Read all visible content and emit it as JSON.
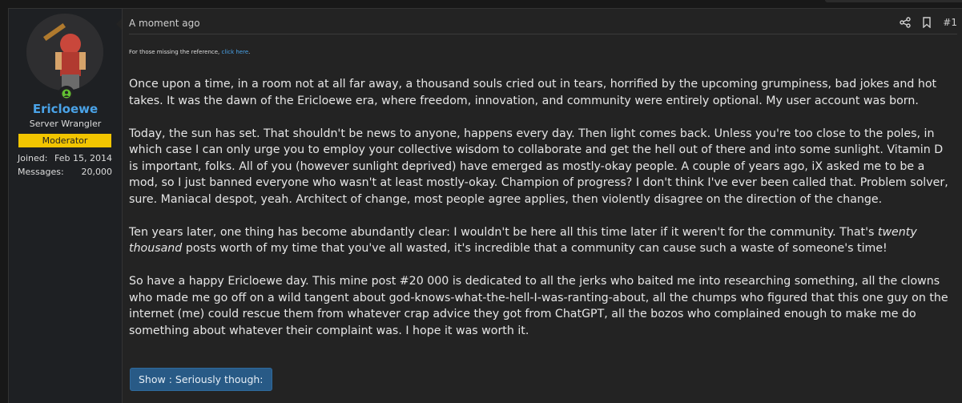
{
  "user": {
    "name": "Ericloewe",
    "title": "Server Wrangler",
    "banner": "Moderator",
    "joined_label": "Joined:",
    "joined_value": "Feb 15, 2014",
    "messages_label": "Messages:",
    "messages_value": "20,000"
  },
  "post": {
    "timestamp": "A moment ago",
    "number": "#1",
    "note_prefix": "For those missing the reference, ",
    "note_link": "click here",
    "note_suffix": ".",
    "p1": "Once upon a time, in a room not at all far away, a thousand souls cried out in tears, horrified by the upcoming grumpiness, bad jokes and hot takes. It was the dawn of the Ericloewe era, where freedom, innovation, and community were entirely optional. My user account was born.",
    "p2": "Today, the sun has set. That shouldn't be news to anyone, happens every day. Then light comes back. Unless you're too close to the poles, in which case I can only urge you to employ your collective wisdom to collaborate and get the hell out of there and into some sunlight. Vitamin D is important, folks. All of you (however sunlight deprived) have emerged as mostly-okay people. A couple of years ago, iX asked me to be a mod, so I just banned everyone who wasn't at least mostly-okay. Champion of progress? I don't think I've ever been called that. Problem solver, sure. Maniacal despot, yeah. Architect of change, most people agree applies, then violently disagree on the direction of the change.",
    "p3_a": "Ten years later, one thing has become abundantly clear: I wouldn't be here all this time later if it weren't for the community. That's ",
    "p3_em": "twenty thousand",
    "p3_b": " posts worth of my time that you've all wasted, it's incredible that a community can cause such a waste of someone's time!",
    "p4": "So have a happy Ericloewe day. This mine post #20 000 is dedicated to all the jerks who baited me into researching something, all the clowns who made me go off on a wild tangent about god-knows-what-the-hell-I-was-ranting-about, all the chumps who figured that this one guy on the internet (me) could rescue them from whatever crap advice they got from ChatGPT, all the bozos who complained enough to make me do something about whatever their complaint was. I hope it was worth it.",
    "spoiler_label": "Show : Seriously though:"
  },
  "icons": [
    "share-icon",
    "bookmark-icon",
    "online-status-icon"
  ],
  "colors": {
    "accent": "#4aa3e8",
    "banner": "#f2c500",
    "button": "#285a86",
    "online": "#63c132"
  }
}
